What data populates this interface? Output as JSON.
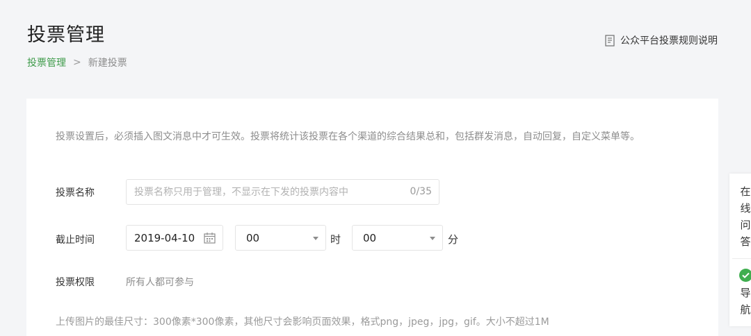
{
  "header": {
    "title": "投票管理",
    "rules_link": "公众平台投票规则说明"
  },
  "breadcrumb": {
    "parent": "投票管理",
    "separator": ">",
    "current": "新建投票"
  },
  "form": {
    "notice": "投票设置后，必须插入图文消息中才可生效。投票将统计该投票在各个渠道的综合结果总和，包括群发消息，自动回复，自定义菜单等。",
    "name_label": "投票名称",
    "name_placeholder": "投票名称只用于管理，不显示在下发的投票内容中",
    "name_counter": "0/35",
    "deadline_label": "截止时间",
    "deadline_date": "2019-04-10",
    "hour_value": "00",
    "hour_unit": "时",
    "minute_value": "00",
    "minute_unit": "分",
    "permission_label": "投票权限",
    "permission_value": "所有人都可参与",
    "upload_hint": "上传图片的最佳尺寸：300像素*300像素，其他尺寸会影响页面效果，格式png，jpeg，jpg，gif。大小不超过1M"
  },
  "side_float": {
    "qa_chars": [
      "在",
      "线",
      "问",
      "答"
    ],
    "nav_chars": [
      "导",
      "航"
    ]
  },
  "colors": {
    "accent_green": "#3f9b4b",
    "background": "#f4f5f7"
  }
}
